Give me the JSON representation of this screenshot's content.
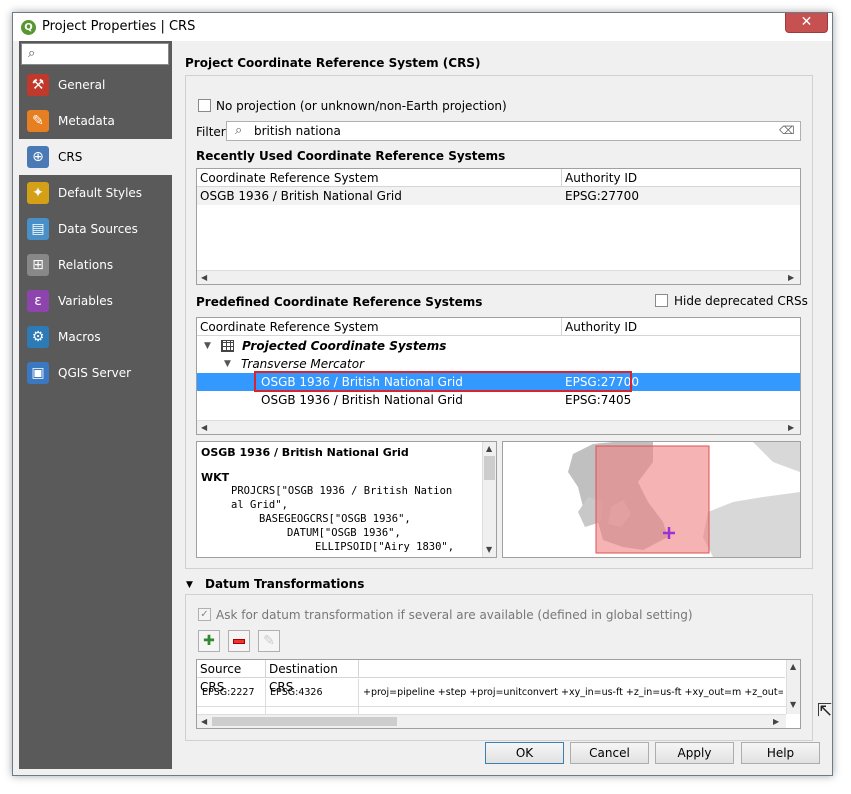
{
  "window": {
    "title": "Project Properties | CRS",
    "close": "✕",
    "app_icon": "Q"
  },
  "sidebar": {
    "search_placeholder": "",
    "items": [
      {
        "label": "General",
        "icon": "wrench-hammer-icon",
        "glyph": "⚒",
        "color": "#c0392b"
      },
      {
        "label": "Metadata",
        "icon": "document-icon",
        "glyph": "✎",
        "color": "#e67e22"
      },
      {
        "label": "CRS",
        "icon": "globe-icon",
        "glyph": "⊕",
        "color": "#4a7ab5"
      },
      {
        "label": "Default Styles",
        "icon": "paint-brush-icon",
        "glyph": "✦",
        "color": "#d4a017"
      },
      {
        "label": "Data Sources",
        "icon": "data-sources-icon",
        "glyph": "▤",
        "color": "#4a90c8"
      },
      {
        "label": "Relations",
        "icon": "relations-icon",
        "glyph": "⊞",
        "color": "#888888"
      },
      {
        "label": "Variables",
        "icon": "variables-icon",
        "glyph": "ε",
        "color": "#8e44ad"
      },
      {
        "label": "Macros",
        "icon": "macros-icon",
        "glyph": "⚙",
        "color": "#2c7bb6"
      },
      {
        "label": "QGIS Server",
        "icon": "qgis-server-icon",
        "glyph": "▣",
        "color": "#3b78c2"
      }
    ]
  },
  "crs": {
    "section_title": "Project Coordinate Reference System (CRS)",
    "no_projection_label": "No projection (or unknown/non-Earth projection)",
    "filter_label": "Filter",
    "filter_value": "british nationa",
    "recent_title": "Recently Used Coordinate Reference Systems",
    "col_crs": "Coordinate Reference System",
    "col_authority": "Authority ID",
    "recent_rows": [
      {
        "name": "OSGB 1936 / British National Grid",
        "auth": "EPSG:27700"
      }
    ],
    "predefined_title": "Predefined Coordinate Reference Systems",
    "hide_deprecated_label": "Hide deprecated CRSs",
    "tree_projected": "Projected Coordinate Systems",
    "tree_transverse": "Transverse Mercator",
    "predefined_rows": [
      {
        "name": "OSGB 1936 / British National Grid",
        "auth": "EPSG:27700"
      },
      {
        "name": "OSGB 1936 / British National Grid",
        "auth": "EPSG:7405"
      }
    ],
    "detail_title": "OSGB 1936 / British National Grid",
    "wkt_label": "WKT",
    "wkt_lines": [
      "PROJCRS[\"OSGB 1936 / British Nation",
      "al Grid\",",
      "BASEGEOGCRS[\"OSGB 1936\",",
      "DATUM[\"OSGB 1936\",",
      "ELLIPSOID[\"Airy 1830\","
    ]
  },
  "datum": {
    "title": "Datum Transformations",
    "ask_label": "Ask for datum transformation if several are available (defined in global setting)",
    "add_icon": "add-icon",
    "remove_icon": "remove-icon",
    "edit_icon": "edit-icon",
    "col_source": "Source CRS",
    "col_dest": "Destination CRS",
    "rows": [
      {
        "source": "EPSG:2227",
        "dest": "EPSG:4326",
        "pipeline": "+proj=pipeline +step +proj=unitconvert +xy_in=us-ft +z_in=us-ft +xy_out=m +z_out=m +step +inv +proj=lc"
      }
    ]
  },
  "buttons": {
    "ok": "OK",
    "cancel": "Cancel",
    "apply": "Apply",
    "help": "Help"
  },
  "colors": {
    "selection": "#3399ff",
    "highlight_box": "#d9232d",
    "map_overlay": "#f08080"
  }
}
